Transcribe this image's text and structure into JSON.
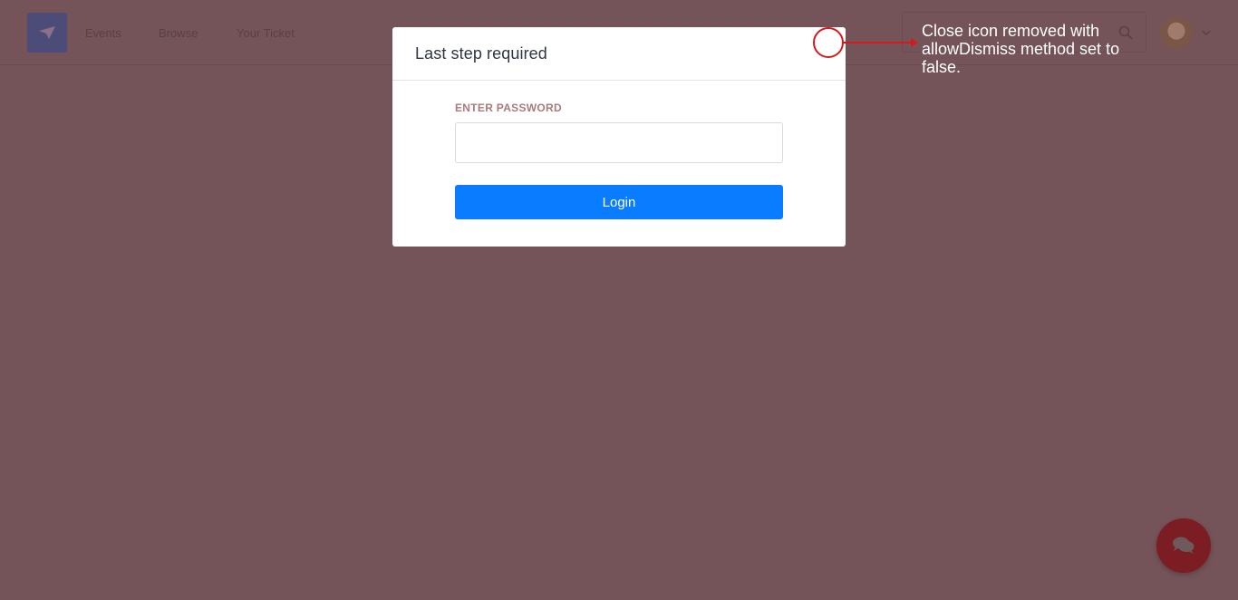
{
  "nav": {
    "links": [
      "Events",
      "Browse",
      "Your Ticket"
    ]
  },
  "icons": {
    "logo": "paper-plane-icon",
    "search": "search-icon",
    "avatar_caret": "chevron-down-icon",
    "chat": "chat-bubbles-icon"
  },
  "modal": {
    "title": "Last step required",
    "password_label": "ENTER PASSWORD",
    "password_value": "",
    "password_placeholder": "",
    "login_label": "Login"
  },
  "annotation": {
    "text": "Close icon removed with allowDismiss method set to false."
  },
  "colors": {
    "backdrop": "#755459",
    "primary_button": "#0a7cff",
    "annotation": "#d41a1a",
    "chat_button": "#7b1d22"
  }
}
